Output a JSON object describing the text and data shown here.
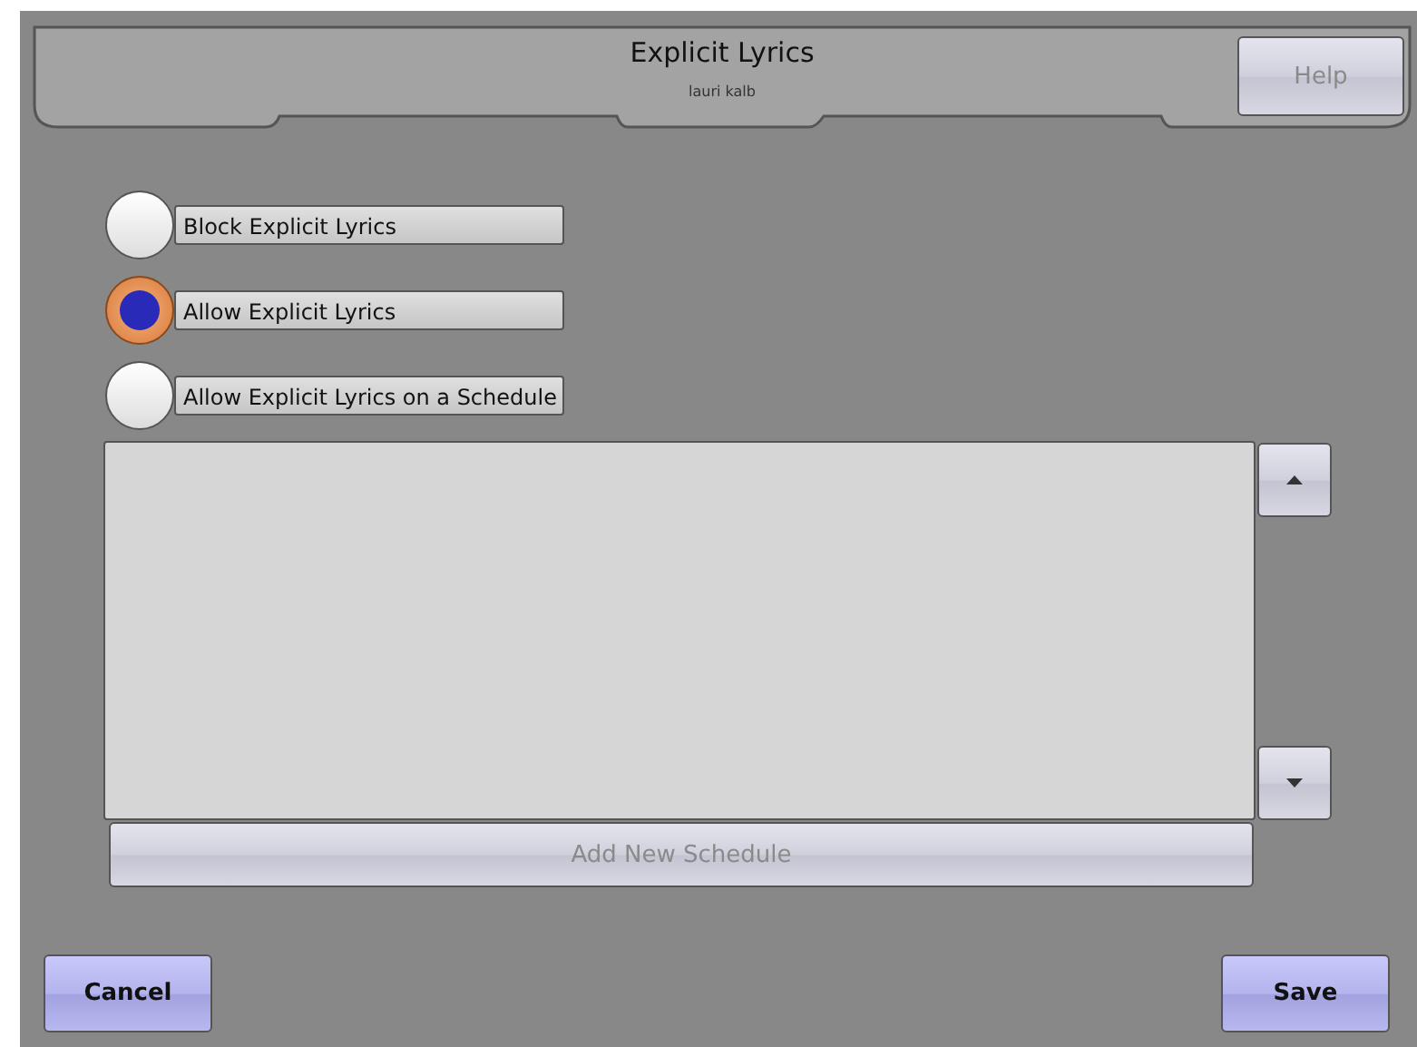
{
  "header": {
    "title": "Explicit Lyrics",
    "subtitle": "lauri kalb"
  },
  "help_button": {
    "label": "Help",
    "disabled": true
  },
  "options": [
    {
      "label": "Block Explicit Lyrics",
      "selected": false
    },
    {
      "label": "Allow Explicit Lyrics",
      "selected": true
    },
    {
      "label": "Allow Explicit Lyrics on a Schedule",
      "selected": false
    }
  ],
  "schedule_list": {
    "add_button": {
      "label": "Add New Schedule",
      "disabled": true
    }
  },
  "buttons": [
    {
      "label": "Cancel"
    },
    {
      "label": "Save"
    }
  ]
}
